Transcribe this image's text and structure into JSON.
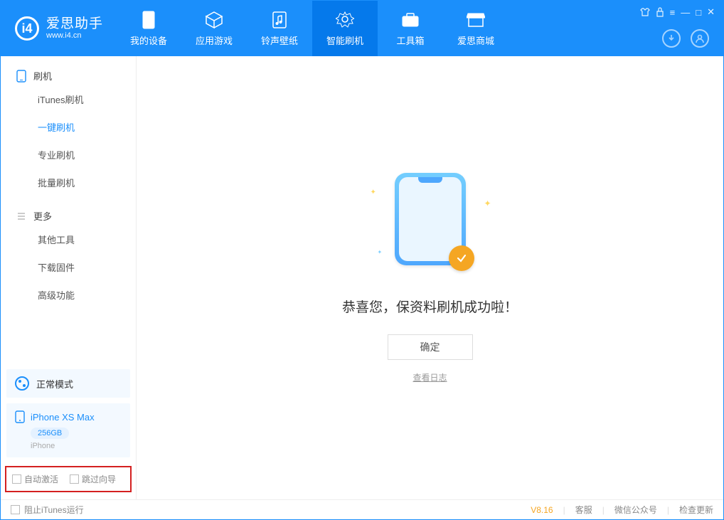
{
  "brand": {
    "name": "爱思助手",
    "url": "www.i4.cn"
  },
  "nav": {
    "items": [
      {
        "label": "我的设备",
        "icon": "device"
      },
      {
        "label": "应用游戏",
        "icon": "cube"
      },
      {
        "label": "铃声壁纸",
        "icon": "music"
      },
      {
        "label": "智能刷机",
        "icon": "refresh"
      },
      {
        "label": "工具箱",
        "icon": "toolbox"
      },
      {
        "label": "爱思商城",
        "icon": "store"
      }
    ]
  },
  "sidebar": {
    "group_flash": "刷机",
    "flash_items": [
      "iTunes刷机",
      "一键刷机",
      "专业刷机",
      "批量刷机"
    ],
    "group_more": "更多",
    "more_items": [
      "其他工具",
      "下载固件",
      "高级功能"
    ]
  },
  "mode": {
    "label": "正常模式"
  },
  "device": {
    "name": "iPhone XS Max",
    "storage": "256GB",
    "type": "iPhone"
  },
  "checks": {
    "auto_activate": "自动激活",
    "skip_guide": "跳过向导"
  },
  "result": {
    "headline": "恭喜您，保资料刷机成功啦！",
    "ok": "确定",
    "log": "查看日志"
  },
  "footer": {
    "block_itunes": "阻止iTunes运行",
    "version": "V8.16",
    "support": "客服",
    "wechat": "微信公众号",
    "update": "检查更新"
  }
}
